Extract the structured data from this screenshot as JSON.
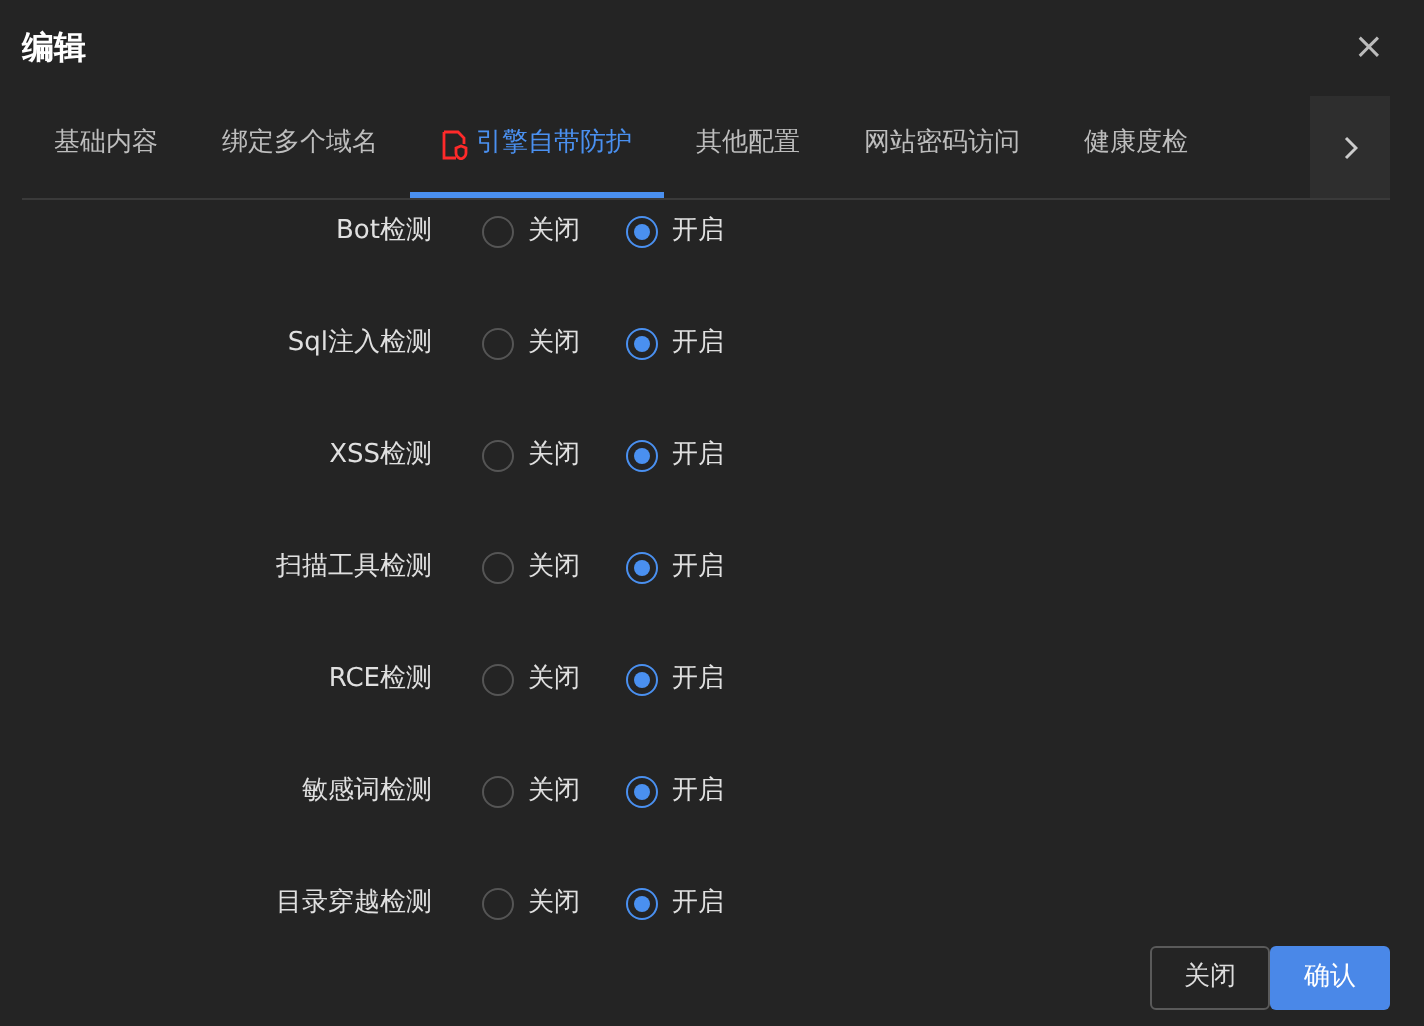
{
  "dialog": {
    "title": "编辑",
    "close": "×"
  },
  "tabs": [
    {
      "label": "基础内容",
      "selected": false
    },
    {
      "label": "绑定多个域名",
      "selected": false
    },
    {
      "label": "引擎自带防护",
      "selected": true,
      "icon": true
    },
    {
      "label": "其他配置",
      "selected": false
    },
    {
      "label": "网站密码访问",
      "selected": false
    },
    {
      "label": "健康度检",
      "selected": false
    }
  ],
  "settings": [
    {
      "label": "Bot检测",
      "options": [
        {
          "label": "关闭",
          "selected": false
        },
        {
          "label": "开启",
          "selected": true
        }
      ]
    },
    {
      "label": "Sql注入检测",
      "options": [
        {
          "label": "关闭",
          "selected": false
        },
        {
          "label": "开启",
          "selected": true
        }
      ]
    },
    {
      "label": "XSS检测",
      "options": [
        {
          "label": "关闭",
          "selected": false
        },
        {
          "label": "开启",
          "selected": true
        }
      ]
    },
    {
      "label": "扫描工具检测",
      "options": [
        {
          "label": "关闭",
          "selected": false
        },
        {
          "label": "开启",
          "selected": true
        }
      ]
    },
    {
      "label": "RCE检测",
      "options": [
        {
          "label": "关闭",
          "selected": false
        },
        {
          "label": "开启",
          "selected": true
        }
      ]
    },
    {
      "label": "敏感词检测",
      "options": [
        {
          "label": "关闭",
          "selected": false
        },
        {
          "label": "开启",
          "selected": true
        }
      ]
    },
    {
      "label": "目录穿越检测",
      "options": [
        {
          "label": "关闭",
          "selected": false
        },
        {
          "label": "开启",
          "selected": true
        }
      ]
    }
  ],
  "buttons": [
    {
      "label": "关闭",
      "kind": "secondary"
    },
    {
      "label": "确认",
      "kind": "primary"
    }
  ]
}
